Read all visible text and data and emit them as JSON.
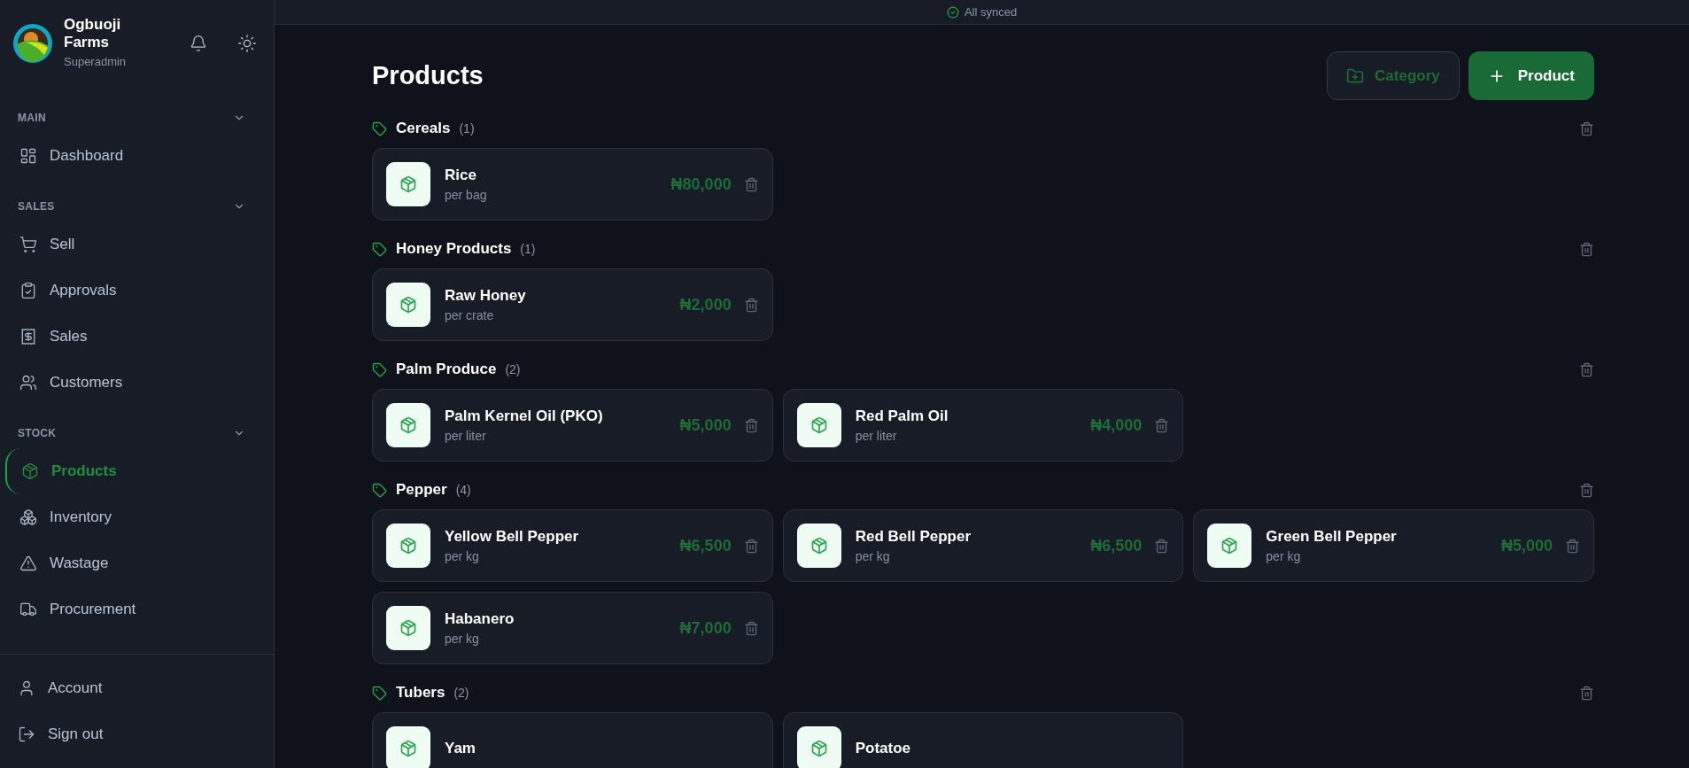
{
  "brand": {
    "name": "Ogbuoji Farms",
    "role": "Superadmin"
  },
  "sidebar": {
    "sections": [
      {
        "title": "MAIN",
        "expanded": true,
        "items": [
          {
            "label": "Dashboard",
            "selected": false
          }
        ]
      },
      {
        "title": "SALES",
        "expanded": true,
        "items": [
          {
            "label": "Sell",
            "selected": false
          },
          {
            "label": "Approvals",
            "selected": false
          },
          {
            "label": "Sales",
            "selected": false
          },
          {
            "label": "Customers",
            "selected": false
          }
        ]
      },
      {
        "title": "STOCK",
        "expanded": true,
        "items": [
          {
            "label": "Products",
            "selected": true
          },
          {
            "label": "Inventory",
            "selected": false
          },
          {
            "label": "Wastage",
            "selected": false
          },
          {
            "label": "Procurement",
            "selected": false
          }
        ]
      }
    ],
    "footer": [
      {
        "label": "Account"
      },
      {
        "label": "Sign out"
      }
    ]
  },
  "status_bar": {
    "text": "All synced"
  },
  "page": {
    "title": "Products",
    "buttons": [
      {
        "label": "Category",
        "kind": "secondary"
      },
      {
        "label": "Product",
        "kind": "primary"
      }
    ]
  },
  "categories": [
    {
      "name": "Cereals",
      "count": "(1)",
      "products": [
        {
          "name": "Rice",
          "unit": "per bag",
          "price": "₦80,000"
        }
      ]
    },
    {
      "name": "Honey Products",
      "count": "(1)",
      "products": [
        {
          "name": "Raw Honey",
          "unit": "per crate",
          "price": "₦2,000"
        }
      ]
    },
    {
      "name": "Palm Produce",
      "count": "(2)",
      "products": [
        {
          "name": "Palm Kernel Oil (PKO)",
          "unit": "per liter",
          "price": "₦5,000"
        },
        {
          "name": "Red Palm Oil",
          "unit": "per liter",
          "price": "₦4,000"
        }
      ]
    },
    {
      "name": "Pepper",
      "count": "(4)",
      "products": [
        {
          "name": "Yellow Bell Pepper",
          "unit": "per kg",
          "price": "₦6,500"
        },
        {
          "name": "Red Bell Pepper",
          "unit": "per kg",
          "price": "₦6,500"
        },
        {
          "name": "Green Bell Pepper",
          "unit": "per kg",
          "price": "₦5,000"
        },
        {
          "name": "Habanero",
          "unit": "per kg",
          "price": "₦7,000"
        }
      ]
    },
    {
      "name": "Tubers",
      "count": "(2)",
      "products": [
        {
          "name": "Yam"
        },
        {
          "name": "Potatoe"
        }
      ]
    }
  ]
}
